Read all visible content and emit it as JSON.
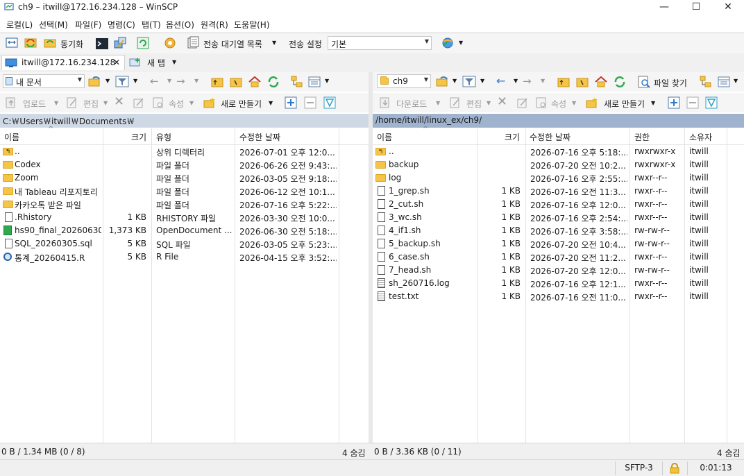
{
  "window": {
    "title": "ch9 – itwill@172.16.234.128 – WinSCP",
    "minimize": "—",
    "maximize": "☐",
    "close": "✕"
  },
  "menu": [
    "로컬(L)",
    "선택(M)",
    "파일(F)",
    "명령(C)",
    "탭(T)",
    "옵션(O)",
    "원격(R)",
    "도움말(H)"
  ],
  "toolbar": {
    "sync_label": "동기화",
    "queue_label": "전송 대기열 목록",
    "transfer_settings_label": "전송 설정",
    "transfer_preset": "기본"
  },
  "tabs": {
    "session": "itwill@172.16.234.128",
    "session_close": "✕",
    "new_tab": "새 탭"
  },
  "left": {
    "location": "내 문서",
    "upload": "업로드",
    "edit": "편집",
    "props": "속성",
    "new": "새로 만들기",
    "path": "C:￦Users￦itwill￦Documents￦",
    "columns": [
      "이름",
      "크기",
      "유형",
      "수정한 날짜"
    ],
    "files": [
      {
        "name": "..",
        "size": "",
        "type": "상위 디렉터리",
        "date": "2026-07-01 오후 12:0...",
        "icon": "parent-dir-icon"
      },
      {
        "name": "Codex",
        "size": "",
        "type": "파일 폴더",
        "date": "2026-06-26 오전 9:43:...",
        "icon": "folder-icon"
      },
      {
        "name": "Zoom",
        "size": "",
        "type": "파일 폴더",
        "date": "2026-03-05 오전 9:18:...",
        "icon": "folder-icon"
      },
      {
        "name": "내 Tableau 리포지토리",
        "size": "",
        "type": "파일 폴더",
        "date": "2026-06-12 오전 10:1...",
        "icon": "folder-icon"
      },
      {
        "name": "카카오톡 받은 파일",
        "size": "",
        "type": "파일 폴더",
        "date": "2026-07-16 오후 5:22:...",
        "icon": "folder-icon"
      },
      {
        "name": ".Rhistory",
        "size": "1 KB",
        "type": "RHISTORY 파일",
        "date": "2026-03-30 오전 10:0...",
        "icon": "file-icon"
      },
      {
        "name": "hs90_final_20260630...",
        "size": "1,373 KB",
        "type": "OpenDocument ...",
        "date": "2026-06-30 오전 5:18:...",
        "icon": "spreadsheet-icon"
      },
      {
        "name": "SQL_20260305.sql",
        "size": "5 KB",
        "type": "SQL 파일",
        "date": "2026-03-05 오후 5:23:...",
        "icon": "file-icon"
      },
      {
        "name": "통계_20260415.R",
        "size": "5 KB",
        "type": "R File",
        "date": "2026-04-15 오후 3:52:...",
        "icon": "r-file-icon"
      }
    ],
    "status": "0 B / 1.34 MB (0 / 8)",
    "hidden": "4 숨김"
  },
  "right": {
    "location": "ch9",
    "download": "다운로드",
    "edit": "편집",
    "props": "속성",
    "new": "새로 만들기",
    "find": "파일 찾기",
    "path": "/home/itwill/linux_ex/ch9/",
    "columns": [
      "이름",
      "크기",
      "수정한 날짜",
      "권한",
      "소유자"
    ],
    "files": [
      {
        "name": "..",
        "size": "",
        "date": "2026-07-16 오후 5:18:...",
        "perm": "rwxrwxr-x",
        "owner": "itwill",
        "icon": "parent-dir-icon"
      },
      {
        "name": "backup",
        "size": "",
        "date": "2026-07-20 오전 10:2...",
        "perm": "rwxrwxr-x",
        "owner": "itwill",
        "icon": "folder-icon"
      },
      {
        "name": "log",
        "size": "",
        "date": "2026-07-16 오후 2:55:...",
        "perm": "rwxr--r--",
        "owner": "itwill",
        "icon": "folder-icon"
      },
      {
        "name": "1_grep.sh",
        "size": "1 KB",
        "date": "2026-07-16 오전 11:3...",
        "perm": "rwxr--r--",
        "owner": "itwill",
        "icon": "file-icon"
      },
      {
        "name": "2_cut.sh",
        "size": "1 KB",
        "date": "2026-07-16 오후 12:0...",
        "perm": "rwxr--r--",
        "owner": "itwill",
        "icon": "file-icon"
      },
      {
        "name": "3_wc.sh",
        "size": "1 KB",
        "date": "2026-07-16 오후 2:54:...",
        "perm": "rwxr--r--",
        "owner": "itwill",
        "icon": "file-icon"
      },
      {
        "name": "4_if1.sh",
        "size": "1 KB",
        "date": "2026-07-16 오후 3:58:...",
        "perm": "rw-rw-r--",
        "owner": "itwill",
        "icon": "file-icon"
      },
      {
        "name": "5_backup.sh",
        "size": "1 KB",
        "date": "2026-07-20 오전 10:4...",
        "perm": "rw-rw-r--",
        "owner": "itwill",
        "icon": "file-icon"
      },
      {
        "name": "6_case.sh",
        "size": "1 KB",
        "date": "2026-07-20 오전 11:2...",
        "perm": "rwxr--r--",
        "owner": "itwill",
        "icon": "file-icon"
      },
      {
        "name": "7_head.sh",
        "size": "1 KB",
        "date": "2026-07-20 오후 12:0...",
        "perm": "rw-rw-r--",
        "owner": "itwill",
        "icon": "file-icon"
      },
      {
        "name": "sh_260716.log",
        "size": "1 KB",
        "date": "2026-07-16 오후 12:1...",
        "perm": "rwxr--r--",
        "owner": "itwill",
        "icon": "log-file-icon"
      },
      {
        "name": "test.txt",
        "size": "1 KB",
        "date": "2026-07-16 오전 11:0...",
        "perm": "rwxr--r--",
        "owner": "itwill",
        "icon": "text-file-icon"
      }
    ],
    "status": "0 B / 3.36 KB (0 / 11)",
    "hidden": "4 숨김"
  },
  "statusbar": {
    "protocol": "SFTP-3",
    "elapsed": "0:01:13"
  },
  "colors": {
    "left_path_bg": "#cfd9e5",
    "right_path_bg": "#9fb3cf",
    "folder": "#f6c548"
  }
}
